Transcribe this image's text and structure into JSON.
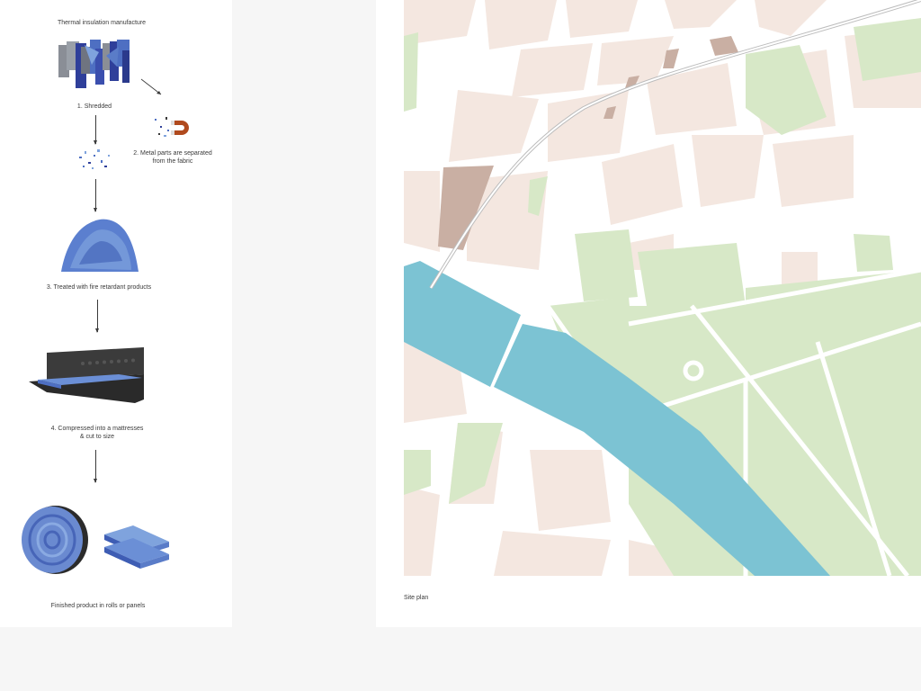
{
  "diagram": {
    "title": "Thermal insulation manufacture",
    "steps": [
      {
        "label": "1. Shredded"
      },
      {
        "label_line1": "2. Metal parts are separated",
        "label_line2": "from the fabric"
      },
      {
        "label": "3. Treated with fire retardant products"
      },
      {
        "label_line1": "4. Compressed into a mattresses",
        "label_line2": "& cut to size"
      },
      {
        "label": "Finished product in rolls or panels"
      }
    ],
    "colors": {
      "denim_dark": "#2f3f9a",
      "denim_mid": "#4e6fc2",
      "denim_light": "#7fa3dd",
      "grey_fabric": "#8a8e96",
      "magnet": "#b04a1e"
    }
  },
  "site_plan": {
    "caption": "Site plan",
    "colors": {
      "background": "#ffffff",
      "buildings": "#f4e7e0",
      "special_buildings": "#c9afa3",
      "parks": "#d7e8c7",
      "water": "#7cc3d3",
      "railway": "#c8c8c8"
    }
  }
}
